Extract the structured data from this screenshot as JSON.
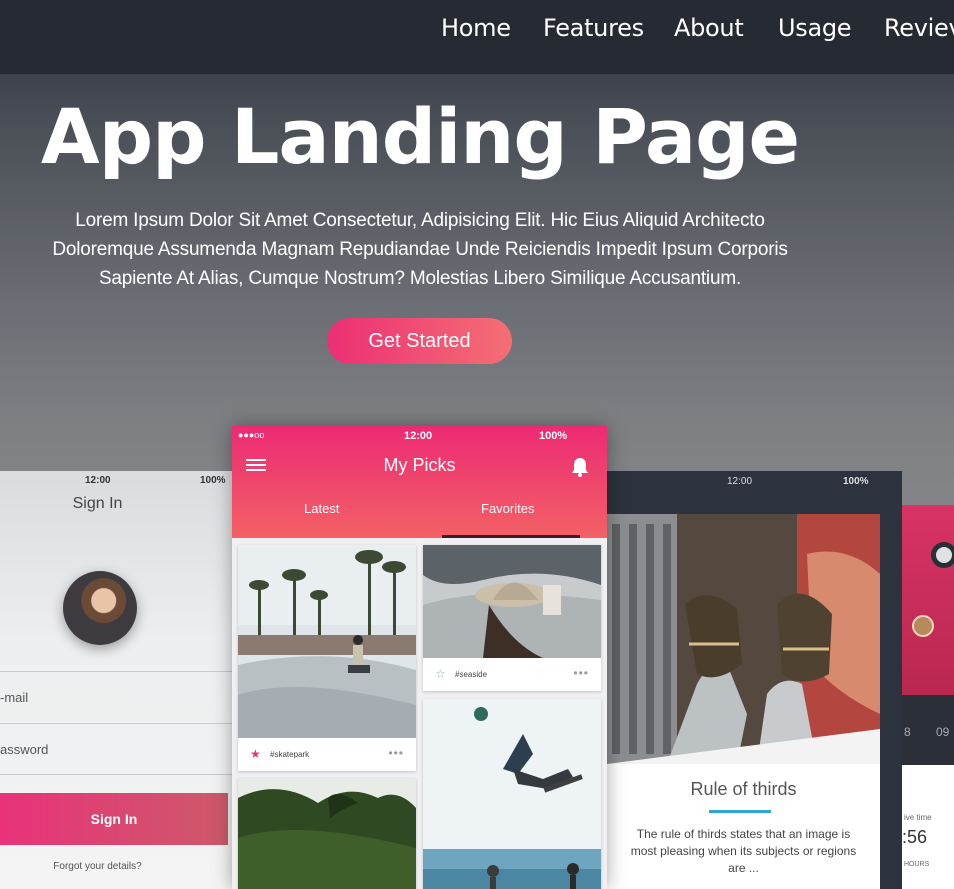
{
  "nav": {
    "links": [
      "Home",
      "Features",
      "About",
      "Usage",
      "Reviev"
    ]
  },
  "hero": {
    "title": "App Landing Page",
    "description_lines": [
      "Lorem Ipsum Dolor Sit Amet Consectetur, Adipisicing Elit. Hic Eius Aliquid Architecto",
      "Doloremque Assumenda Magnam Repudiandae Unde Reiciendis Impedit Ipsum Corporis",
      "Sapiente At Alias, Cumque Nostrum? Molestias Libero Similique Accusantium."
    ],
    "cta_label": "Get Started"
  },
  "phone_signin": {
    "status_time": "12:00",
    "status_battery": "100%",
    "title": "Sign In",
    "email_label": "-mail",
    "password_label": "assword",
    "button_label": "Sign In",
    "forgot_label": "Forgot your details?"
  },
  "phone_picks": {
    "status_signal": "●●●oo",
    "status_time": "12:00",
    "status_battery": "100%",
    "title": "My Picks",
    "tabs": [
      "Latest",
      "Favorites"
    ],
    "active_tab": "Favorites",
    "cards": [
      {
        "tag": "#skatepark",
        "favorited": true
      },
      {
        "tag": "#seaside",
        "favorited": false
      }
    ]
  },
  "phone_article": {
    "status_time": "12:00",
    "status_battery": "100%",
    "title": "Rule of thirds",
    "text": "The rule of thirds states that an image is most pleasing when its subjects or regions are ..."
  },
  "phone_far": {
    "label_time": "ive time",
    "value": ":56",
    "unit": "HOURS",
    "small_labels": [
      "8",
      "09"
    ]
  },
  "colors": {
    "accent_start": "#ec2f74",
    "accent_end": "#f46f74",
    "nav_bg": "#262a33",
    "rule_accent": "#2ea6d6"
  }
}
